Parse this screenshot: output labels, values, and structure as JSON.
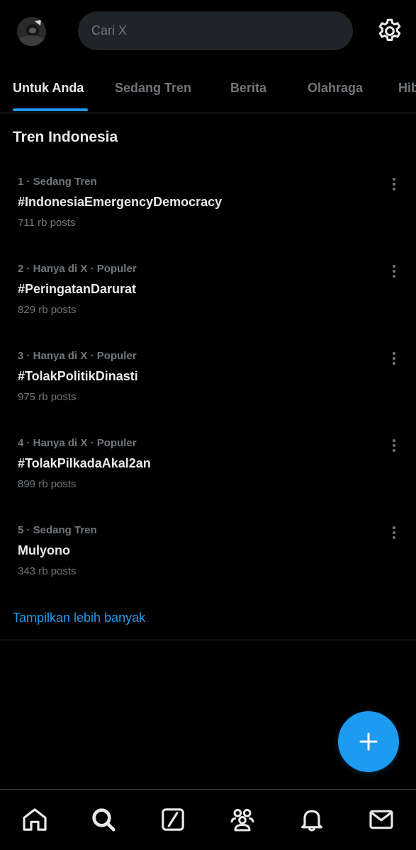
{
  "header": {
    "search_placeholder": "Cari X",
    "avatar_icon": "user-avatar",
    "settings_icon": "gear-icon"
  },
  "tabs": [
    {
      "label": "Untuk Anda",
      "active": true
    },
    {
      "label": "Sedang Tren",
      "active": false
    },
    {
      "label": "Berita",
      "active": false
    },
    {
      "label": "Olahraga",
      "active": false
    },
    {
      "label": "Hiburan",
      "active": false
    }
  ],
  "section": {
    "title": "Tren Indonesia"
  },
  "trends": [
    {
      "meta": "1 · Sedang Tren",
      "name": "#IndonesiaEmergencyDemocracy",
      "count": "711 rb posts"
    },
    {
      "meta": "2 · Hanya di X · Populer",
      "name": "#PeringatanDarurat",
      "count": "829 rb posts"
    },
    {
      "meta": "3 · Hanya di X · Populer",
      "name": "#TolakPolitikDinasti",
      "count": "975 rb posts"
    },
    {
      "meta": "4 · Hanya di X · Populer",
      "name": "#TolakPilkadaAkal2an",
      "count": "899 rb posts"
    },
    {
      "meta": "5 · Sedang Tren",
      "name": "Mulyono",
      "count": "343 rb posts"
    }
  ],
  "show_more": "Tampilkan lebih banyak",
  "fab_icon": "plus-icon",
  "bottom_nav": [
    {
      "icon": "home-icon"
    },
    {
      "icon": "search-icon",
      "active": true
    },
    {
      "icon": "grok-icon"
    },
    {
      "icon": "communities-icon"
    },
    {
      "icon": "bell-icon"
    },
    {
      "icon": "mail-icon"
    }
  ],
  "colors": {
    "background": "#000000",
    "accent": "#1d9bf0",
    "text_primary": "#e7e9ea",
    "text_secondary": "#71767b",
    "divider": "#2f3336"
  }
}
